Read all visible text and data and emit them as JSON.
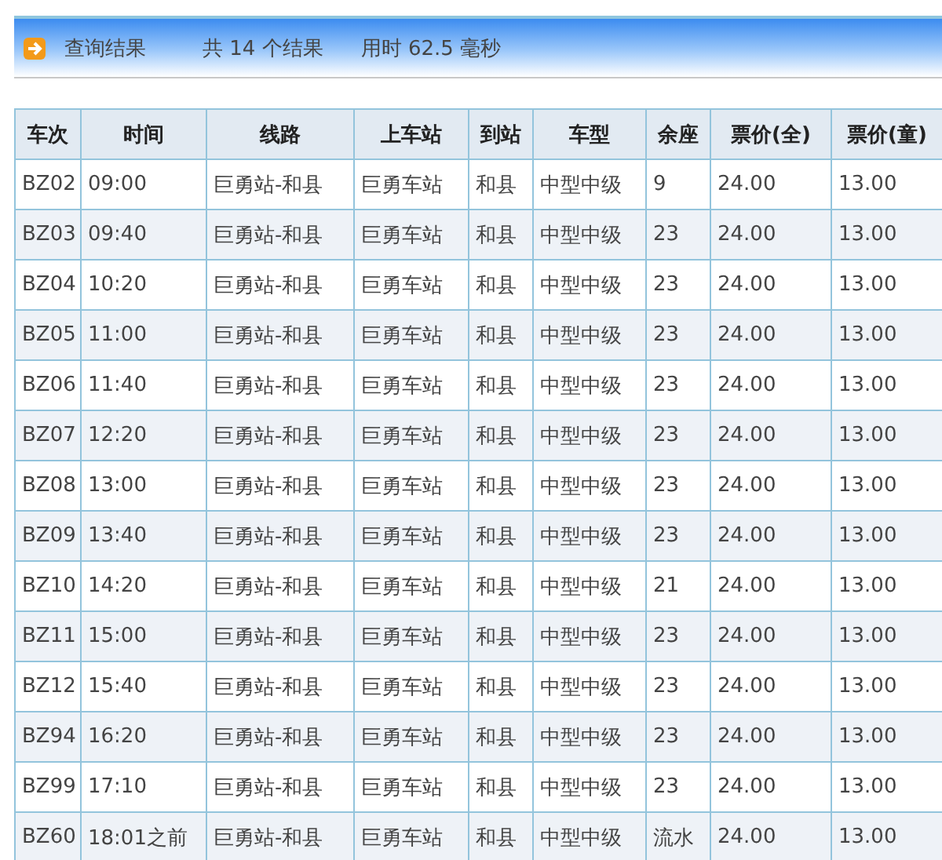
{
  "header": {
    "title": "查询结果",
    "count_text": "共 14 个结果",
    "time_text": "用时 62.5 毫秒"
  },
  "table": {
    "columns": [
      "车次",
      "时间",
      "线路",
      "上车站",
      "到站",
      "车型",
      "余座",
      "票价(全)",
      "票价(童)"
    ],
    "rows": [
      [
        "BZ02",
        "09:00",
        "巨勇站-和县",
        "巨勇车站",
        "和县",
        "中型中级",
        "9",
        "24.00",
        "13.00"
      ],
      [
        "BZ03",
        "09:40",
        "巨勇站-和县",
        "巨勇车站",
        "和县",
        "中型中级",
        "23",
        "24.00",
        "13.00"
      ],
      [
        "BZ04",
        "10:20",
        "巨勇站-和县",
        "巨勇车站",
        "和县",
        "中型中级",
        "23",
        "24.00",
        "13.00"
      ],
      [
        "BZ05",
        "11:00",
        "巨勇站-和县",
        "巨勇车站",
        "和县",
        "中型中级",
        "23",
        "24.00",
        "13.00"
      ],
      [
        "BZ06",
        "11:40",
        "巨勇站-和县",
        "巨勇车站",
        "和县",
        "中型中级",
        "23",
        "24.00",
        "13.00"
      ],
      [
        "BZ07",
        "12:20",
        "巨勇站-和县",
        "巨勇车站",
        "和县",
        "中型中级",
        "23",
        "24.00",
        "13.00"
      ],
      [
        "BZ08",
        "13:00",
        "巨勇站-和县",
        "巨勇车站",
        "和县",
        "中型中级",
        "23",
        "24.00",
        "13.00"
      ],
      [
        "BZ09",
        "13:40",
        "巨勇站-和县",
        "巨勇车站",
        "和县",
        "中型中级",
        "23",
        "24.00",
        "13.00"
      ],
      [
        "BZ10",
        "14:20",
        "巨勇站-和县",
        "巨勇车站",
        "和县",
        "中型中级",
        "21",
        "24.00",
        "13.00"
      ],
      [
        "BZ11",
        "15:00",
        "巨勇站-和县",
        "巨勇车站",
        "和县",
        "中型中级",
        "23",
        "24.00",
        "13.00"
      ],
      [
        "BZ12",
        "15:40",
        "巨勇站-和县",
        "巨勇车站",
        "和县",
        "中型中级",
        "23",
        "24.00",
        "13.00"
      ],
      [
        "BZ94",
        "16:20",
        "巨勇站-和县",
        "巨勇车站",
        "和县",
        "中型中级",
        "23",
        "24.00",
        "13.00"
      ],
      [
        "BZ99",
        "17:10",
        "巨勇站-和县",
        "巨勇车站",
        "和县",
        "中型中级",
        "23",
        "24.00",
        "13.00"
      ],
      [
        "BZ60",
        "18:01之前",
        "巨勇站-和县",
        "巨勇车站",
        "和县",
        "中型中级",
        "流水",
        "24.00",
        "13.00"
      ]
    ]
  }
}
